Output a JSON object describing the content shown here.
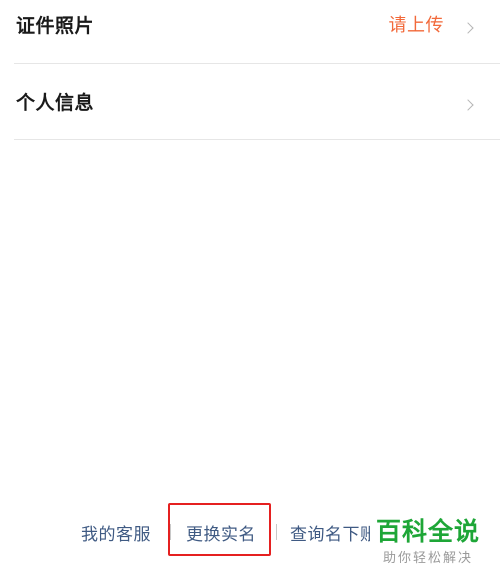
{
  "rows": [
    {
      "label": "证件照片",
      "value": "请上传"
    },
    {
      "label": "个人信息",
      "value": ""
    }
  ],
  "footer": {
    "service": "我的客服",
    "change_name": "更换实名",
    "query": "查询名下账号"
  },
  "watermark": {
    "title": "百科全说",
    "subtitle": "助你轻松解决"
  },
  "colors": {
    "value_orange": "#f2693a",
    "link_blue": "#3f5a83",
    "highlight_red": "#e52020",
    "watermark_green": "#1ea637"
  }
}
